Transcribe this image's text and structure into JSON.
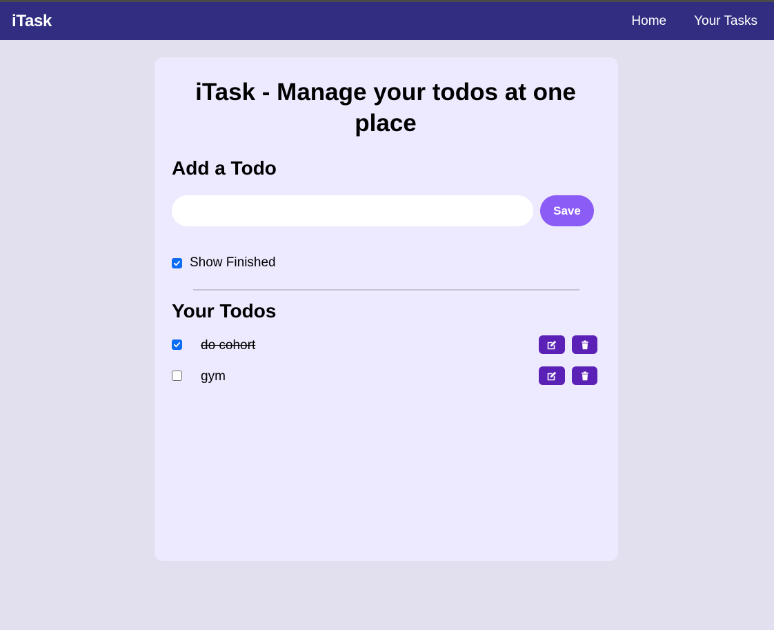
{
  "navbar": {
    "brand": "iTask",
    "links": [
      "Home",
      "Your Tasks"
    ]
  },
  "main": {
    "title": "iTask - Manage your todos at one place",
    "add_section_title": "Add a Todo",
    "input": {
      "value": "",
      "placeholder": ""
    },
    "save_label": "Save",
    "show_finished": {
      "label": "Show Finished",
      "checked": true
    },
    "todos_section_title": "Your Todos",
    "todos": [
      {
        "text": "do cohort",
        "done": true
      },
      {
        "text": "gym",
        "done": false
      }
    ]
  },
  "icons": {
    "edit": "edit-icon",
    "delete": "trash-icon",
    "check": "checkmark-icon"
  },
  "colors": {
    "navbar": "#312e81",
    "background": "#e2e0ee",
    "card": "#ede9fe",
    "save_button": "#8b5cf6",
    "action_button": "#5b21b6",
    "checkbox": "#0b6cf5"
  }
}
